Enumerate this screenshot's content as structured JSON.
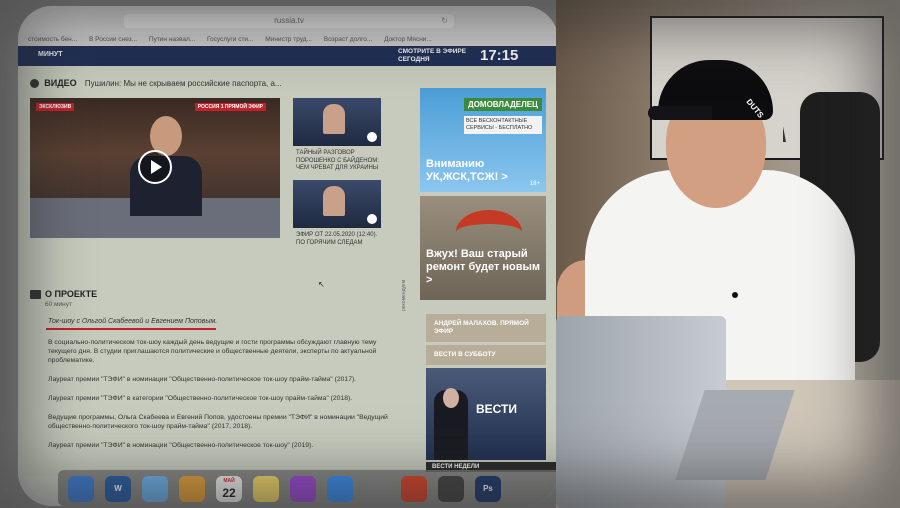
{
  "browser": {
    "url": "russia.tv",
    "bookmarks": [
      "стоимость бен...",
      "В России снез...",
      "Путин назвал...",
      "Госуслуги сти...",
      "Министр труд...",
      "Возраст долго...",
      "Доктор Мясни..."
    ]
  },
  "site_header": {
    "left_label": "МИНУТ",
    "live_label_1": "СМОТРИТЕ В ЭФИРЕ",
    "live_label_2": "СЕГОДНЯ",
    "clock": "17:15"
  },
  "video_section": {
    "title": "ВИДЕО",
    "subtitle": "Пушилин: Мы не скрываем российские паспорта, а...",
    "badge_left": "ЭКСКЛЮЗИВ",
    "badge_right": "РОССИЯ 1 ПРЯМОЙ ЭФИР",
    "thumb1_text": "ТАЙНЫЙ РАЗГОВОР ПОРОШЕНКО С БАЙДЕНОМ: ЧЕМ ЧРЕВАТ ДЛЯ УКРАИНЫ",
    "thumb2_text": "ЭФИР ОТ 22.05.2020 (12:40). ПО ГОРЯЧИМ СЛЕДАМ"
  },
  "ads": {
    "ad1_brand": "ДОМОВЛАДЕЛЕЦ",
    "ad1_sub": "ВСЕ ВЕСКОНТАКТНЫЕ СЕРВИСЫ - БЕСПЛАТНО",
    "ad1_headline": "Вниманию УК,ЖСК,ТСЖ! >",
    "ad1_age": "18+",
    "ad2_headline": "Вжух! Ваш старый ремонт будет новым >"
  },
  "project": {
    "title": "О ПРОЕКТЕ",
    "duration": "60 минут",
    "hosts": "Ток-шоу с Ольгой Скабеевой и Евгением Поповым.",
    "paragraphs": [
      "В социально-политическом ток-шоу каждый день ведущие и гости программы обсуждают главную тему текущего дня. В студии приглашаются политические и общественные деятели, эксперты по актуальной проблематике.",
      "Лауреат премии \"ТЭФИ\" в номинации \"Общественно-политическое ток-шоу прайм-тайма\" (2017).",
      "Лауреат премии \"ТЭФИ\" в категории \"Общественно-политическое ток-шоу прайм-тайма\" (2018).",
      "Ведущие программы, Ольга Скабеева и Евгений Попов, удостоены премии \"ТЭФИ\" в номинации \"Ведущий общественно-политического ток-шоу прайм-тайма\" (2017, 2018).",
      "Лауреат премии \"ТЭФИ\" в номинации \"Общественно-политическое ток-шоу\" (2019)."
    ],
    "vertical_label": "рекомендуем"
  },
  "sidebar": {
    "items": [
      "АНДРЕЙ МАЛАХОВ. ПРЯМОЙ ЭФИР",
      "ВЕСТИ В СУББОТУ"
    ],
    "image_title": "ВЕСТИ",
    "bottom_label": "ВЕСТИ НЕДЕЛИ"
  },
  "dock": {
    "items": [
      {
        "icon": "finder-icon",
        "label": "",
        "color": "#3d7fd8"
      },
      {
        "icon": "word-icon",
        "label": "W",
        "color": "#2a5ea8"
      },
      {
        "icon": "messages-icon",
        "label": "",
        "color": "#6fb3f0"
      },
      {
        "icon": "photos-icon",
        "label": "",
        "color": "#e8a23a"
      },
      {
        "icon": "calendar-icon",
        "label": "22",
        "color": "#f2f2f2"
      },
      {
        "icon": "notes-icon",
        "label": "",
        "color": "#f3d86a"
      },
      {
        "icon": "podcasts-icon",
        "label": "",
        "color": "#9b4ad6"
      },
      {
        "icon": "appstore-icon",
        "label": "",
        "color": "#3a8ef0"
      },
      {
        "icon": "settings-icon",
        "label": "",
        "color": "#8a8a8a"
      },
      {
        "icon": "chrome-icon",
        "label": "",
        "color": "#d9442c"
      },
      {
        "icon": "finalcut-icon",
        "label": "",
        "color": "#444"
      },
      {
        "icon": "photoshop-icon",
        "label": "Ps",
        "color": "#1f3a6e"
      }
    ],
    "calendar_month": "МАЙ"
  },
  "photo": {
    "cap_text": "DUTS"
  }
}
